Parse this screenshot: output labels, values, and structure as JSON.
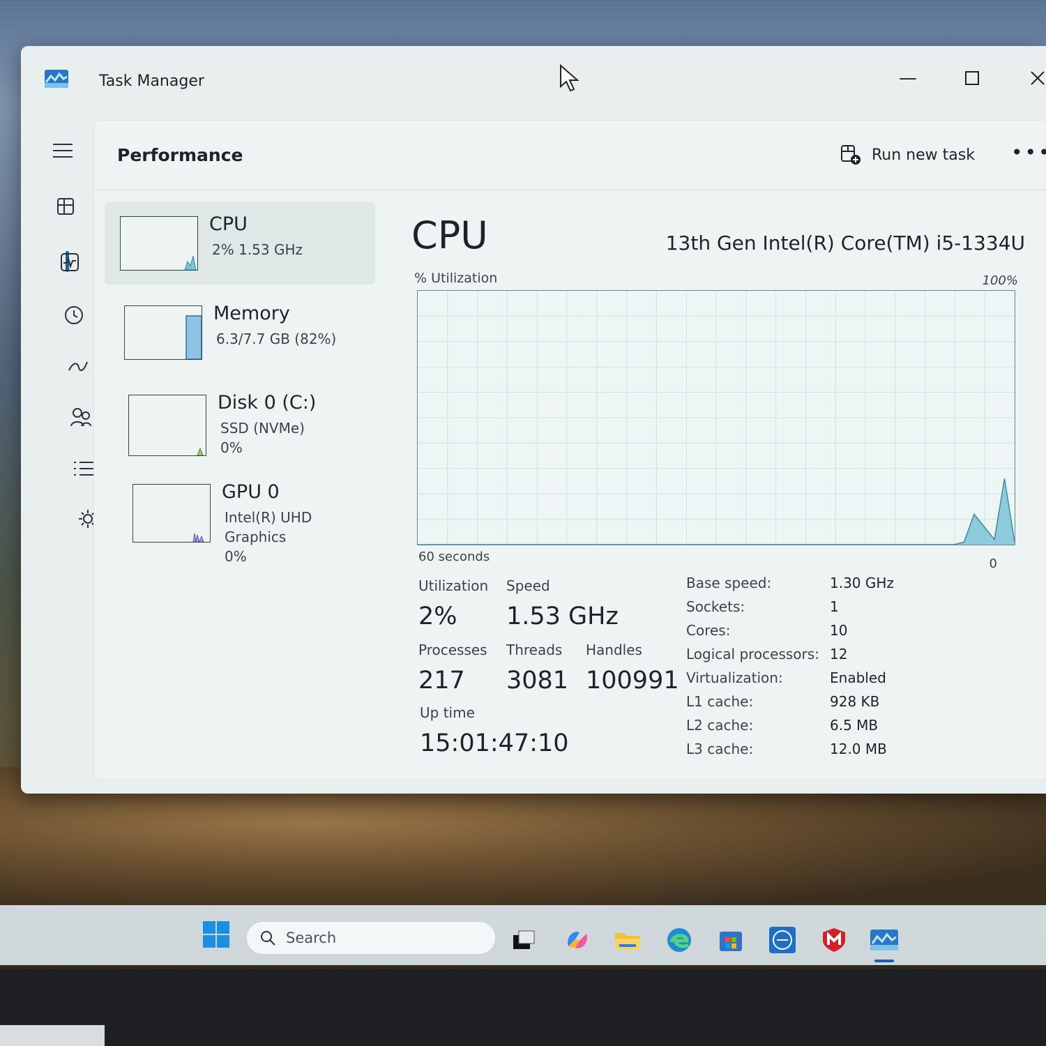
{
  "window": {
    "title": "Task Manager"
  },
  "header": {
    "title": "Performance",
    "run_new_task": "Run new task",
    "more": "•••"
  },
  "resources": [
    {
      "name": "CPU",
      "sub1": "2%  1.53 GHz",
      "sub2": "",
      "sub3": ""
    },
    {
      "name": "Memory",
      "sub1": "6.3/7.7 GB (82%)",
      "sub2": "",
      "sub3": ""
    },
    {
      "name": "Disk 0 (C:)",
      "sub1": "SSD (NVMe)",
      "sub2": "0%",
      "sub3": ""
    },
    {
      "name": "GPU 0",
      "sub1": "Intel(R) UHD Graphics",
      "sub2": "0%",
      "sub3": ""
    }
  ],
  "detail": {
    "title": "CPU",
    "model": "13th Gen Intel(R) Core(TM) i5-1334U",
    "util_label": "% Utilization",
    "max_label": "100%",
    "time_label": "60 seconds",
    "min_label": "0"
  },
  "stats": {
    "utilization": {
      "label": "Utilization",
      "value": "2%"
    },
    "speed": {
      "label": "Speed",
      "value": "1.53 GHz"
    },
    "processes": {
      "label": "Processes",
      "value": "217"
    },
    "threads": {
      "label": "Threads",
      "value": "3081"
    },
    "handles": {
      "label": "Handles",
      "value": "100991"
    },
    "uptime": {
      "label": "Up time",
      "value": "15:01:47:10"
    }
  },
  "specs": [
    {
      "key": "Base speed:",
      "value": "1.30 GHz"
    },
    {
      "key": "Sockets:",
      "value": "1"
    },
    {
      "key": "Cores:",
      "value": "10"
    },
    {
      "key": "Logical processors:",
      "value": "12"
    },
    {
      "key": "Virtualization:",
      "value": "Enabled"
    },
    {
      "key": "L1 cache:",
      "value": "928 KB"
    },
    {
      "key": "L2 cache:",
      "value": "6.5 MB"
    },
    {
      "key": "L3 cache:",
      "value": "12.0 MB"
    }
  ],
  "taskbar": {
    "search_placeholder": "Search"
  },
  "chart_data": {
    "type": "area",
    "x_label": "60 seconds",
    "ylim": [
      0,
      100
    ],
    "series": [
      {
        "values": [
          0,
          0,
          0,
          0,
          0,
          0,
          0,
          0,
          0,
          0,
          0,
          0,
          0,
          0,
          0,
          0,
          0,
          0,
          0,
          0,
          0,
          0,
          0,
          0,
          0,
          0,
          0,
          0,
          0,
          0,
          0,
          0,
          0,
          0,
          0,
          0,
          0,
          0,
          0,
          0,
          0,
          0,
          0,
          0,
          0,
          0,
          0,
          0,
          0,
          0,
          0,
          0,
          0,
          0,
          1,
          12,
          7,
          2,
          26,
          1
        ]
      }
    ],
    "colors": {
      "fill": "#7cc3d6",
      "line": "#3f8aa3"
    }
  }
}
